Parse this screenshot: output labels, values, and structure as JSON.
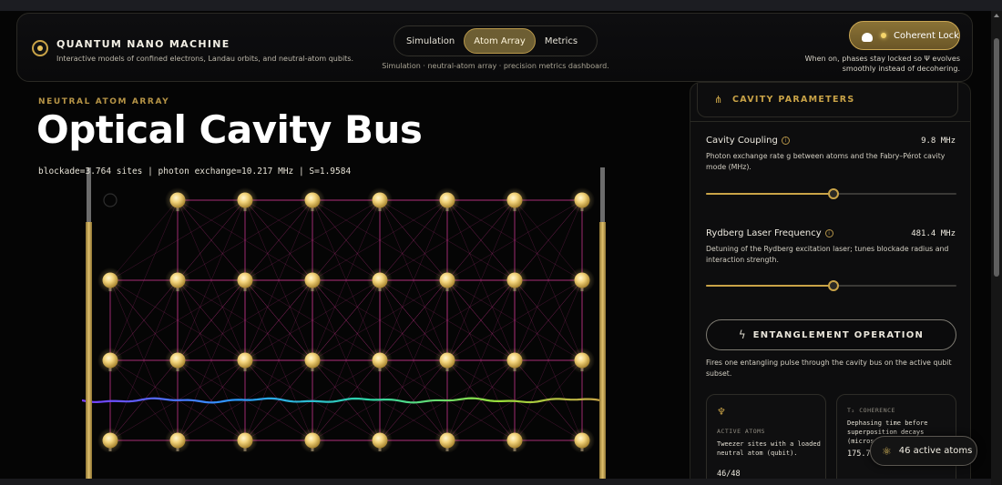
{
  "header": {
    "brand_title": "QUANTUM NANO MACHINE",
    "brand_subtitle": "Interactive models of confined electrons, Landau orbits, and neutral-atom qubits.",
    "tabs": [
      {
        "label": "Simulation",
        "active": false
      },
      {
        "label": "Atom Array",
        "active": true
      },
      {
        "label": "Metrics",
        "active": false
      }
    ],
    "nav_caption": "Simulation · neutral-atom array · precision metrics dashboard.",
    "lock_button": {
      "label": "Coherent Lock",
      "icon": "cloud-icon"
    },
    "lock_caption": "When on, phases stay locked so Ψ evolves smoothly instead of decohering."
  },
  "main": {
    "eyebrow": "NEUTRAL ATOM ARRAY",
    "title": "Optical Cavity Bus",
    "stats": "blockade=3.764 sites | photon exchange=10.217 MHz | S=1.9584"
  },
  "panel": {
    "heading": "CAVITY PARAMETERS",
    "heading_icon": "tuning-fork-icon",
    "params": [
      {
        "name": "Cavity Coupling",
        "value": "9.8 MHz",
        "description": "Photon exchange rate g between atoms and the Fabry–Pérot cavity mode (MHz).",
        "fraction": 0.51
      },
      {
        "name": "Rydberg Laser Frequency",
        "value": "481.4 MHz",
        "description": "Detuning of the Rydberg excitation laser; tunes blockade radius and interaction strength.",
        "fraction": 0.51
      }
    ],
    "entangle_button": "ENTANGLEMENT OPERATION",
    "entangle_description": "Fires one entangling pulse through the cavity bus on the active qubit subset.",
    "metrics": [
      {
        "icon": "atom-tree-icon",
        "label": "ACTIVE ATOMS",
        "description": "Tweezer sites with a loaded neutral atom (qubit).",
        "value": "46/48"
      },
      {
        "icon": "",
        "label": "T₂ COHERENCE",
        "description": "Dephasing time before superposition decays (micros",
        "value": "175.7"
      }
    ]
  },
  "toast": {
    "label": "46 active atoms",
    "icon": "atom-icon"
  },
  "colors": {
    "accent": "#c9a347",
    "background": "#050505",
    "link_line": "#c8358c"
  }
}
